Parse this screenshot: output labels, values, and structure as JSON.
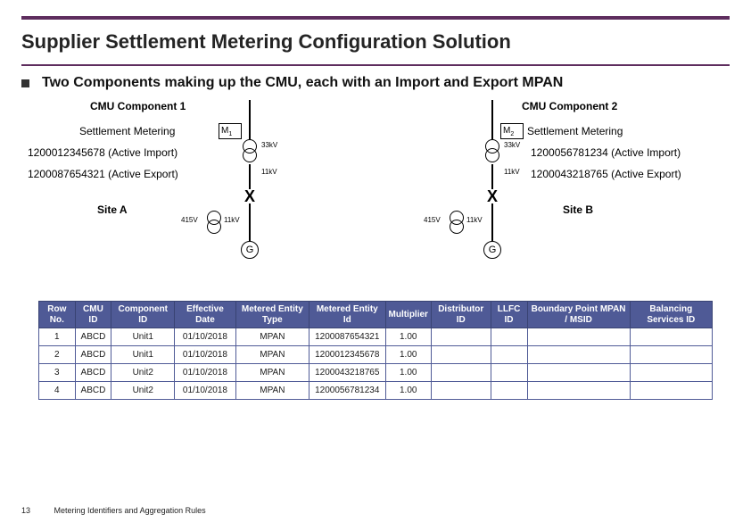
{
  "title": "Supplier Settlement Metering Configuration Solution",
  "bullet": "Two Components making up the CMU, each with an Import and Export MPAN",
  "diagram": {
    "comp1": {
      "title": "CMU Component 1",
      "settlement_label": "Settlement Metering",
      "meter_symbol": "M",
      "meter_sub": "1",
      "mpan_import": "1200012345678 (Active Import)",
      "mpan_export": "1200087654321 (Active Export)",
      "site": "Site A",
      "volt_top": "33kV",
      "volt_mid": "11kV",
      "volt_415": "415V",
      "volt_11": "11kV",
      "gen": "G"
    },
    "comp2": {
      "title": "CMU Component 2",
      "settlement_label": "Settlement Metering",
      "meter_symbol": "M",
      "meter_sub": "2",
      "mpan_import": "1200056781234 (Active Import)",
      "mpan_export": "1200043218765 (Active Export)",
      "site": "Site B",
      "volt_top": "33kV",
      "volt_mid": "11kV",
      "volt_415": "415V",
      "volt_11": "11kV",
      "gen": "G"
    },
    "cross": "X"
  },
  "table": {
    "headers": [
      "Row No.",
      "CMU ID",
      "Component ID",
      "Effective Date",
      "Metered Entity Type",
      "Metered Entity Id",
      "Multiplier",
      "Distributor ID",
      "LLFC ID",
      "Boundary Point MPAN / MSID",
      "Balancing Services ID"
    ],
    "rows": [
      [
        "1",
        "ABCD",
        "Unit1",
        "01/10/2018",
        "MPAN",
        "1200087654321",
        "1.00",
        "",
        "",
        "",
        ""
      ],
      [
        "2",
        "ABCD",
        "Unit1",
        "01/10/2018",
        "MPAN",
        "1200012345678",
        "1.00",
        "",
        "",
        "",
        ""
      ],
      [
        "3",
        "ABCD",
        "Unit2",
        "01/10/2018",
        "MPAN",
        "1200043218765",
        "1.00",
        "",
        "",
        "",
        ""
      ],
      [
        "4",
        "ABCD",
        "Unit2",
        "01/10/2018",
        "MPAN",
        "1200056781234",
        "1.00",
        "",
        "",
        "",
        ""
      ]
    ]
  },
  "footer": {
    "page_num": "13",
    "footer_text": "Metering Identifiers and Aggregation Rules"
  }
}
